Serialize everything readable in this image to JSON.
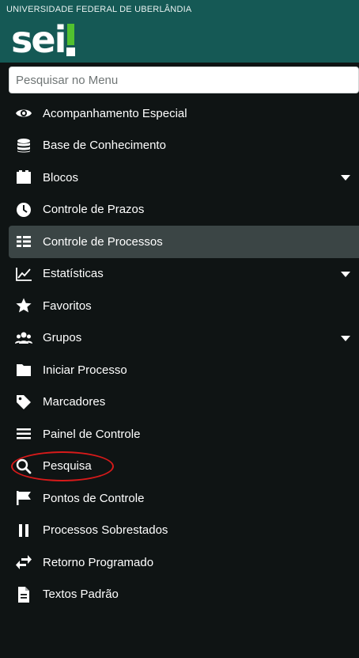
{
  "header": {
    "university": "UNIVERSIDADE FEDERAL DE UBERLÂNDIA",
    "logo_text": "sei",
    "brand_color": "#155955",
    "accent_color": "#52c12f"
  },
  "search": {
    "placeholder": "Pesquisar no Menu",
    "value": ""
  },
  "menu": {
    "items": [
      {
        "label": "Acompanhamento Especial",
        "icon": "eye-icon"
      },
      {
        "label": "Base de Conhecimento",
        "icon": "database-icon"
      },
      {
        "label": "Blocos",
        "icon": "blocks-icon",
        "has_submenu": true
      },
      {
        "label": "Controle de Prazos",
        "icon": "clock-icon"
      },
      {
        "label": "Controle de Processos",
        "icon": "list-icon",
        "active": true
      },
      {
        "label": "Estatísticas",
        "icon": "line-chart-icon",
        "has_submenu": true
      },
      {
        "label": "Favoritos",
        "icon": "star-icon"
      },
      {
        "label": "Grupos",
        "icon": "users-icon",
        "has_submenu": true
      },
      {
        "label": "Iniciar Processo",
        "icon": "folder-icon"
      },
      {
        "label": "Marcadores",
        "icon": "tag-icon"
      },
      {
        "label": "Painel de Controle",
        "icon": "bars-icon"
      },
      {
        "label": "Pesquisa",
        "icon": "search-icon",
        "highlighted": true
      },
      {
        "label": "Pontos de Controle",
        "icon": "flag-icon"
      },
      {
        "label": "Processos Sobrestados",
        "icon": "pause-icon"
      },
      {
        "label": "Retorno Programado",
        "icon": "exchange-icon"
      },
      {
        "label": "Textos Padrão",
        "icon": "file-text-icon"
      }
    ]
  }
}
